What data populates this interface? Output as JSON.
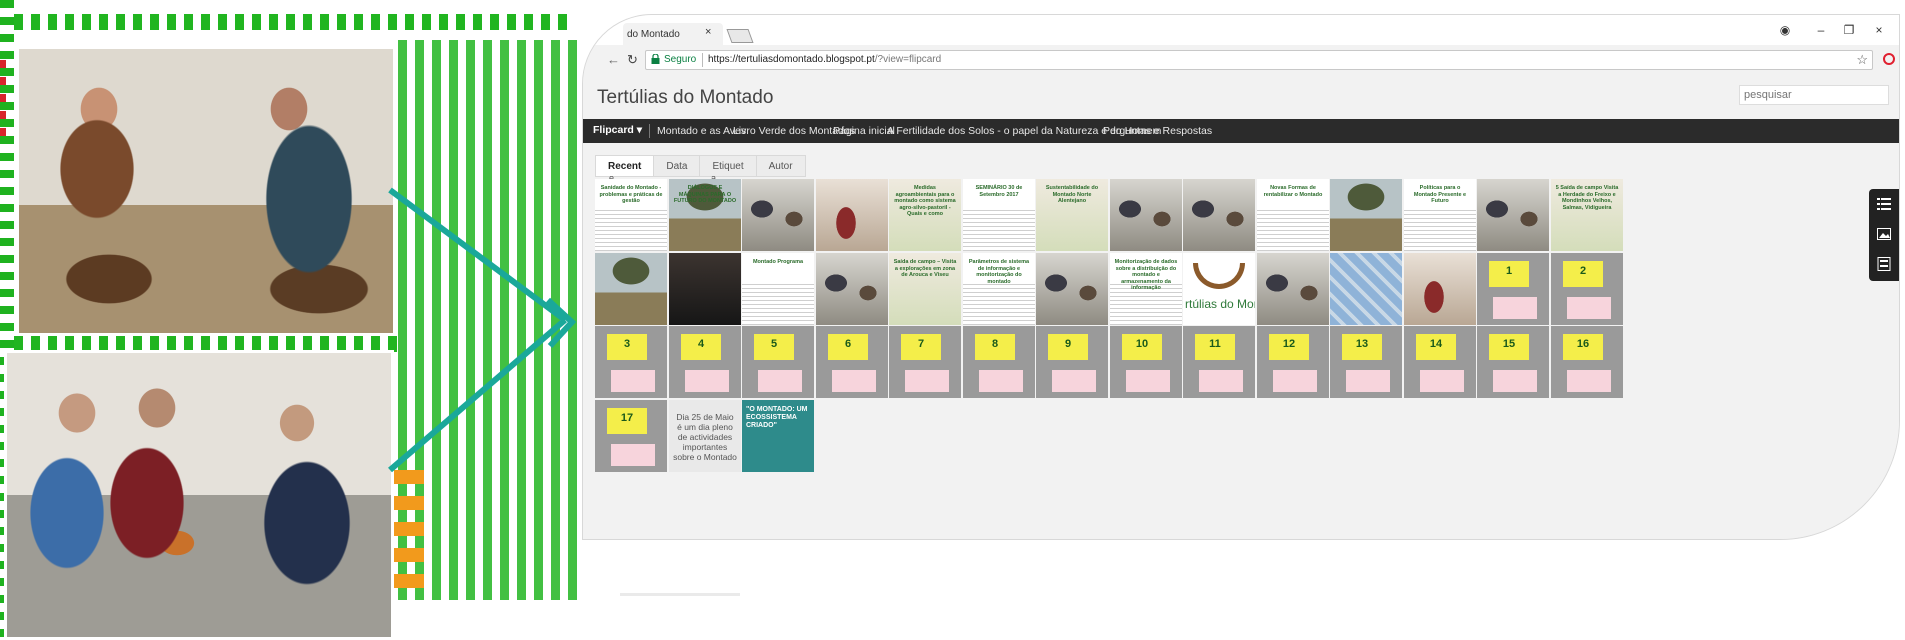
{
  "browser": {
    "tab_title": "do Montado",
    "tab_close": "×",
    "secure_label": "Seguro",
    "url_host": "https://tertuliasdomontado.blogspot.pt",
    "url_path": "/?view=flipcard",
    "window_controls": [
      "account-icon",
      "minimize",
      "restore",
      "close"
    ],
    "window_control_glyphs": [
      "◉",
      "–",
      "❐",
      "×"
    ]
  },
  "blog": {
    "title": "Tertúlias do Montado",
    "search_placeholder": "pesquisar",
    "view_selector": "Flipcard ▾",
    "menu": [
      "Montado e as Aves",
      "Livro Verde dos Montados",
      "Página inicial",
      "A Fertilidade dos Solos - o papel da Natureza e do Homem",
      "Perguntas e Respostas"
    ],
    "view_tabs": [
      "Recent",
      "Data",
      "Etiquet",
      "Autor"
    ],
    "tab_overflow_left": "e",
    "tab_overflow_right": "a"
  },
  "tiles": {
    "row1": [
      {
        "kind": "doc",
        "title": "Sanidade do Montado - problemas e práticas de gestão"
      },
      {
        "kind": "tree",
        "title": "DIÁLOGOS E MÁQUINAS PARA O FUTURO DO MONTADO"
      },
      {
        "kind": "photo",
        "title": ""
      },
      {
        "kind": "red",
        "title": ""
      },
      {
        "kind": "green",
        "title": "Medidas agroambientais para o montado como sistema agro-silvo-pastoril - Quais e como"
      },
      {
        "kind": "doc",
        "title": "SEMINÁRIO 30 de Setembro 2017"
      },
      {
        "kind": "green",
        "title": "Sustentabilidade do Montado Norte Alentejano"
      },
      {
        "kind": "photo",
        "title": ""
      },
      {
        "kind": "photo",
        "title": ""
      },
      {
        "kind": "doc",
        "title": "Novas Formas de rentabilizar o Montado"
      },
      {
        "kind": "tree",
        "title": ""
      },
      {
        "kind": "doc",
        "title": "Políticas para o Montado Presente e Futuro"
      },
      {
        "kind": "photo",
        "title": ""
      },
      {
        "kind": "green",
        "title": "5 Saída de campo Visita a Herdade do Freixo e Mondinhos Velhos, Salmas, Vidigueira"
      }
    ],
    "row2": [
      {
        "kind": "tree",
        "title": ""
      },
      {
        "kind": "dark",
        "title": ""
      },
      {
        "kind": "doc",
        "title": "Montado Programa"
      },
      {
        "kind": "photo",
        "title": ""
      },
      {
        "kind": "green",
        "title": "Saída de campo – Visita a explorações em zona de Arouca e Viseu"
      },
      {
        "kind": "doc",
        "title": "Parâmetros de sistema de informação e monitorização do montado"
      },
      {
        "kind": "photo",
        "title": ""
      },
      {
        "kind": "doc",
        "title": "Monitorização de dados sobre a distribuição do montado e armazenamento da informação"
      },
      {
        "kind": "logo",
        "title": "rtúlias do Montado"
      },
      {
        "kind": "photo",
        "title": ""
      },
      {
        "kind": "cards",
        "title": ""
      },
      {
        "kind": "red",
        "title": ""
      },
      {
        "kind": "posit",
        "title": "1"
      },
      {
        "kind": "posit",
        "title": "2"
      }
    ],
    "row3": [
      {
        "kind": "posit",
        "title": "3"
      },
      {
        "kind": "posit",
        "title": "4"
      },
      {
        "kind": "posit",
        "title": "5"
      },
      {
        "kind": "posit",
        "title": "6"
      },
      {
        "kind": "posit",
        "title": "7"
      },
      {
        "kind": "posit",
        "title": "8"
      },
      {
        "kind": "posit",
        "title": "9"
      },
      {
        "kind": "posit",
        "title": "10"
      },
      {
        "kind": "posit",
        "title": "11"
      },
      {
        "kind": "posit",
        "title": "12"
      },
      {
        "kind": "posit",
        "title": "13"
      },
      {
        "kind": "posit",
        "title": "14"
      },
      {
        "kind": "posit",
        "title": "15"
      },
      {
        "kind": "posit",
        "title": "16"
      }
    ],
    "row4": [
      {
        "kind": "posit",
        "title": "17"
      },
      {
        "kind": "text",
        "title": "Dia 25 de Maio é um dia pleno de actividades importantes sobre o Montado"
      },
      {
        "kind": "teal",
        "title": "\"O MONTADO: UM ECOSSISTEMA CRIADO\""
      }
    ]
  },
  "side_icons": [
    "list-icon",
    "image-icon",
    "info-icon"
  ],
  "colors": {
    "menubar": "#2b2b2b",
    "secure_green": "#0b8043",
    "deco_green": "#21b520",
    "arrow_teal": "#1aa89a"
  }
}
